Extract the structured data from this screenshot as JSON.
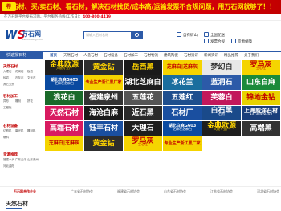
{
  "banner": {
    "icon": "荐",
    "text": "找石材、买/卖石材、看石材，解决石材找货/成本高/运输发票不合规问题，用万石网就够了！！"
  },
  "topbar": {
    "text": "在万石网平台发布求购、平台服务热线(工作日)：",
    "phone": "400-800-4419"
  },
  "header": {
    "logo_mark": "W",
    "logo_mark2": "S",
    "logo_text": "万石网",
    "logo_sub": "wanshiwang.com",
    "search_placeholder": "请输入石材名称",
    "links": [
      "自有矿山",
      "全国配送",
      "货源保障",
      "发票合规"
    ]
  },
  "nav": {
    "category_label": "快速找石材",
    "items": [
      "首页",
      "天然石材",
      "人造石材",
      "石材设备",
      "石材加工",
      "石材物流",
      "建筑陶瓷",
      "石材资讯",
      "新闻资讯",
      "精品推荐",
      "关于我们"
    ]
  },
  "sidebar": {
    "groups": [
      {
        "title": "天然石材",
        "items": [
          "大理石",
          "花岗岩",
          "板岩",
          "砂岩",
          "石灰石",
          "文化石",
          "其它天然"
        ]
      },
      {
        "title": "石材加工",
        "items": [
          "异形",
          "雕刻",
          "拼花",
          "工程板"
        ]
      },
      {
        "title": "石材设备",
        "items": [
          "切割机",
          "磨光机",
          "雕刻机",
          "辅料"
        ]
      },
      {
        "title": "货源推荐",
        "items": [
          "福建水头",
          "广东云浮",
          "山东莱州",
          "河北曲阳"
        ]
      }
    ]
  },
  "tiles": [
    {
      "name": "金典欧源",
      "sub": "大板专业户",
      "bg": "#1e1e1e",
      "fg": "#ffd400"
    },
    {
      "name": "黄金钻",
      "sub": "",
      "bg": "#2d2d2d",
      "fg": "#ffd400"
    },
    {
      "name": "岳西黑",
      "sub": "",
      "bg": "#1a1a1a",
      "fg": "#ffd400"
    },
    {
      "name": "芝麻白|芝麻灰",
      "sub": "",
      "bg": "#f5d400",
      "fg": "#c20000"
    },
    {
      "name": "梦幻白",
      "sub": "",
      "bg": "#e8e8e8",
      "fg": "#333333"
    },
    {
      "name": "罗马灰",
      "sub": "空心柱",
      "bg": "#f5d400",
      "fg": "#c20000"
    },
    {
      "name": "湖北白麻G603",
      "sub": "芝麻灰芝麻白",
      "bg": "#0a4aa0",
      "fg": "#ffffff"
    },
    {
      "name": "专业生产浙江黑厂家",
      "sub": "",
      "bg": "#f5d400",
      "fg": "#c20000"
    },
    {
      "name": "湖北芝麻白",
      "sub": "",
      "bg": "#1e1e1e",
      "fg": "#ffffff"
    },
    {
      "name": "冰花兰",
      "sub": "",
      "bg": "#1a6e9e",
      "fg": "#ffffff"
    },
    {
      "name": "蓝洞石",
      "sub": "",
      "bg": "#2c5aa8",
      "fg": "#ffffff"
    },
    {
      "name": "山东白麻",
      "sub": "",
      "bg": "#1a8a3a",
      "fg": "#ffffff"
    },
    {
      "name": "浪花白",
      "sub": "",
      "bg": "#1a6a2a",
      "fg": "#ffffff"
    },
    {
      "name": "福建泉州",
      "sub": "",
      "bg": "#333333",
      "fg": "#ffffff"
    },
    {
      "name": "五莲花",
      "sub": "",
      "bg": "#555555",
      "fg": "#ffffff"
    },
    {
      "name": "五莲红",
      "sub": "",
      "bg": "#1e4e8e",
      "fg": "#ffffff"
    },
    {
      "name": "芙蓉白",
      "sub": "",
      "bg": "#c2185b",
      "fg": "#ffffff"
    },
    {
      "name": "锦地金钻",
      "sub": "",
      "bg": "#e8d200",
      "fg": "#c20000"
    },
    {
      "name": "天然石材",
      "sub": "",
      "bg": "#d81b60",
      "fg": "#ffffff"
    },
    {
      "name": "海沧白麻",
      "sub": "",
      "bg": "#1a1a1a",
      "fg": "#ffffff"
    },
    {
      "name": "近石黑",
      "sub": "",
      "bg": "#2a2a2a",
      "fg": "#ffffff"
    },
    {
      "name": "石材厂",
      "sub": "",
      "bg": "#1a4fa0",
      "fg": "#ffffff"
    },
    {
      "name": "白石黑",
      "sub": "石材",
      "bg": "#1a4a8a",
      "fg": "#ffffff"
    },
    {
      "name": "上海威洋石材",
      "sub": "13738492205",
      "bg": "#1a3e7a",
      "fg": "#ffffff"
    },
    {
      "name": "高端石材",
      "sub": "",
      "bg": "#d81b60",
      "fg": "#ffffff"
    },
    {
      "name": "钰丰石材",
      "sub": "",
      "bg": "#1a4fa0",
      "fg": "#ffffff"
    },
    {
      "name": "大理石",
      "sub": "",
      "bg": "#1e1e1e",
      "fg": "#ffffff"
    },
    {
      "name": "湖北白麻G603",
      "sub": "芝麻灰芝麻白",
      "bg": "#0a4aa0",
      "fg": "#ffffff"
    },
    {
      "name": "金典欧源",
      "sub": "大板专业户",
      "bg": "#1e1e1e",
      "fg": "#ffd400"
    },
    {
      "name": "高端黑",
      "sub": "",
      "bg": "#333333",
      "fg": "#ffffff"
    },
    {
      "name": "芝麻白|芝麻灰",
      "sub": "",
      "bg": "#f5d400",
      "fg": "#c20000"
    },
    {
      "name": "黄金钻",
      "sub": "",
      "bg": "#2d2d2d",
      "fg": "#ffd400"
    },
    {
      "name": "罗马灰",
      "sub": "空心柱",
      "bg": "#f5d400",
      "fg": "#c20000"
    },
    {
      "name": "专业生产浙江黑厂家",
      "sub": "",
      "bg": "#f5d400",
      "fg": "#c20000"
    }
  ],
  "links_row": {
    "label": "万石网合作企业",
    "items": [
      "广东省石材协会",
      "福建省石材协会",
      "山东省石材协会",
      "江苏省石材协会",
      "河北省石材协会"
    ]
  },
  "footer": {
    "title": "天然石材"
  }
}
